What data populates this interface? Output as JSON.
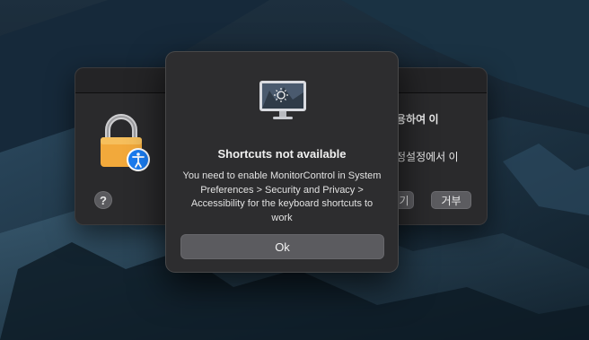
{
  "background_dialog": {
    "text_line_1": "용하여 이",
    "text_line_2": "정설정에서 이",
    "open_button_label": "기",
    "deny_button_label": "거부",
    "help_label": "?",
    "icons": [
      "lock-icon",
      "accessibility-icon",
      "help-icon"
    ]
  },
  "alert": {
    "title": "Shortcuts not available",
    "message": "You need to enable MonitorControl in System Preferences > Security and Privacy > Accessibility for the keyboard shortcuts to work",
    "ok_label": "Ok",
    "icon": "monitor-brightness-icon"
  },
  "colors": {
    "alert_bg": "#2d2d2f",
    "button_bg": "#5b5b5f",
    "lock_gold": "#f2a93b",
    "accessibility_blue": "#1a7cf0"
  }
}
